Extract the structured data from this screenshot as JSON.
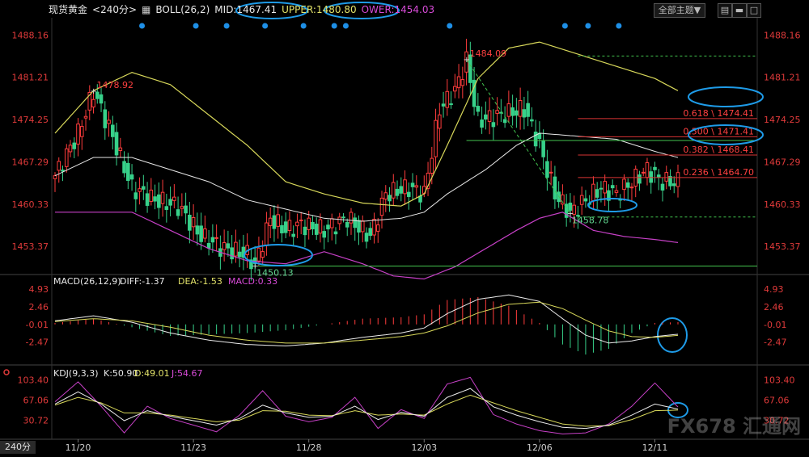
{
  "header": {
    "symbol": "现货黄金",
    "period": "<240分>",
    "indicator": "BOLL(26,2)",
    "mid": "MID:1467.41",
    "upper": "UPPER:1480.80",
    "lower": "OWER:1454.03",
    "theme_button": "全部主题▼"
  },
  "period_tab": "240分",
  "watermark": "FX678 汇通网",
  "chart_data": [
    {
      "type": "candlestick",
      "title": "现货黄金 <240分> BOLL(26,2)",
      "ylim": [
        1449.0,
        1491.0
      ],
      "y_ticks": [
        "1488.16",
        "1481.21",
        "1474.25",
        "1467.29",
        "1460.33",
        "1453.37"
      ],
      "y_tick_values": [
        1488.16,
        1481.21,
        1474.25,
        1467.29,
        1460.33,
        1453.37
      ],
      "x_tick_labels": [
        "11/20",
        "11/23",
        "11/28",
        "12/03",
        "12/06",
        "12/11"
      ],
      "x_tick_index": [
        6,
        36,
        66,
        96,
        126,
        156
      ],
      "annotations": [
        {
          "text": "1478.92",
          "idx": 10,
          "value": 1478.92,
          "color": "#ff4040"
        },
        {
          "text": "1450.13",
          "idx": 52,
          "value": 1450.13,
          "color": "#5fd38d"
        },
        {
          "text": "1484.09",
          "idx": 107,
          "value": 1484.09,
          "color": "#ff4040"
        },
        {
          "text": "1458.78",
          "idx": 134,
          "value": 1458.78,
          "color": "#5fd38d"
        }
      ],
      "fibonacci": [
        {
          "label": "0.618 \\ 1474.41",
          "value": 1474.41
        },
        {
          "label": "0.500 \\ 1471.41",
          "value": 1471.41
        },
        {
          "label": "0.382 \\ 1468.41",
          "value": 1468.41
        },
        {
          "label": "0.236 \\ 1464.70",
          "value": 1464.7
        }
      ],
      "support_levels": [
        1450.13,
        1470.8
      ],
      "ohlc_anchors": [
        [
          0,
          1465
        ],
        [
          6,
          1472
        ],
        [
          10,
          1478.9
        ],
        [
          14,
          1473
        ],
        [
          20,
          1463
        ],
        [
          26,
          1461
        ],
        [
          32,
          1460
        ],
        [
          38,
          1455
        ],
        [
          44,
          1453
        ],
        [
          50,
          1452
        ],
        [
          52,
          1450.2
        ],
        [
          56,
          1458
        ],
        [
          60,
          1456
        ],
        [
          64,
          1457
        ],
        [
          70,
          1456
        ],
        [
          76,
          1458
        ],
        [
          82,
          1455
        ],
        [
          86,
          1462
        ],
        [
          92,
          1463
        ],
        [
          96,
          1462
        ],
        [
          100,
          1476
        ],
        [
          104,
          1479
        ],
        [
          107,
          1484
        ],
        [
          110,
          1474
        ],
        [
          116,
          1475
        ],
        [
          122,
          1476
        ],
        [
          126,
          1470
        ],
        [
          130,
          1462
        ],
        [
          134,
          1458.8
        ],
        [
          138,
          1461
        ],
        [
          142,
          1463
        ],
        [
          146,
          1462
        ],
        [
          150,
          1464
        ],
        [
          154,
          1466
        ],
        [
          158,
          1464
        ],
        [
          162,
          1464
        ]
      ],
      "boll_upper_anchors": [
        [
          0,
          1472
        ],
        [
          10,
          1479
        ],
        [
          20,
          1482
        ],
        [
          30,
          1480
        ],
        [
          40,
          1475
        ],
        [
          50,
          1470
        ],
        [
          60,
          1464
        ],
        [
          70,
          1462
        ],
        [
          80,
          1460.5
        ],
        [
          90,
          1460
        ],
        [
          96,
          1462
        ],
        [
          102,
          1470
        ],
        [
          110,
          1481
        ],
        [
          118,
          1486
        ],
        [
          126,
          1487
        ],
        [
          136,
          1485
        ],
        [
          146,
          1483
        ],
        [
          156,
          1481
        ],
        [
          162,
          1479
        ]
      ],
      "boll_mid_anchors": [
        [
          0,
          1465
        ],
        [
          10,
          1468
        ],
        [
          20,
          1468
        ],
        [
          30,
          1466
        ],
        [
          40,
          1464
        ],
        [
          50,
          1461
        ],
        [
          60,
          1459.5
        ],
        [
          70,
          1458
        ],
        [
          80,
          1457.5
        ],
        [
          90,
          1458
        ],
        [
          96,
          1459
        ],
        [
          102,
          1462
        ],
        [
          112,
          1466
        ],
        [
          120,
          1470
        ],
        [
          126,
          1472
        ],
        [
          136,
          1471.5
        ],
        [
          146,
          1471
        ],
        [
          156,
          1469
        ],
        [
          162,
          1468
        ]
      ],
      "boll_lower_anchors": [
        [
          0,
          1459
        ],
        [
          10,
          1459
        ],
        [
          20,
          1459
        ],
        [
          30,
          1456
        ],
        [
          40,
          1453
        ],
        [
          50,
          1451
        ],
        [
          60,
          1450.5
        ],
        [
          70,
          1452.5
        ],
        [
          80,
          1450.5
        ],
        [
          88,
          1448.5
        ],
        [
          96,
          1448
        ],
        [
          104,
          1450
        ],
        [
          112,
          1453
        ],
        [
          120,
          1456
        ],
        [
          126,
          1458
        ],
        [
          132,
          1459
        ],
        [
          140,
          1456
        ],
        [
          148,
          1455
        ],
        [
          156,
          1454.5
        ],
        [
          162,
          1454
        ]
      ]
    },
    {
      "type": "macd",
      "title": "MACD(26,12,9)",
      "diff_label": "DIFF:-1.37",
      "dea_label": "DEA:-1.53",
      "macd_label": "MACD:0.33",
      "ylim": [
        -5.2,
        5.6
      ],
      "y_ticks": [
        "4.93",
        "2.46",
        "-0.01",
        "-2.47"
      ],
      "y_tick_values": [
        4.93,
        2.46,
        -0.01,
        -2.47
      ],
      "diff_anchors": [
        [
          0,
          0.5
        ],
        [
          10,
          1.2
        ],
        [
          20,
          0.3
        ],
        [
          30,
          -1.2
        ],
        [
          40,
          -2.2
        ],
        [
          50,
          -2.8
        ],
        [
          60,
          -3.0
        ],
        [
          70,
          -2.6
        ],
        [
          80,
          -1.8
        ],
        [
          90,
          -1.2
        ],
        [
          96,
          -0.5
        ],
        [
          102,
          1.5
        ],
        [
          110,
          3.5
        ],
        [
          118,
          4.1
        ],
        [
          126,
          3.2
        ],
        [
          132,
          0.8
        ],
        [
          138,
          -1.5
        ],
        [
          144,
          -2.6
        ],
        [
          150,
          -2.3
        ],
        [
          156,
          -1.7
        ],
        [
          162,
          -1.37
        ]
      ],
      "dea_anchors": [
        [
          0,
          0.4
        ],
        [
          10,
          0.8
        ],
        [
          20,
          0.5
        ],
        [
          30,
          -0.4
        ],
        [
          40,
          -1.5
        ],
        [
          50,
          -2.2
        ],
        [
          60,
          -2.6
        ],
        [
          70,
          -2.6
        ],
        [
          80,
          -2.2
        ],
        [
          90,
          -1.7
        ],
        [
          96,
          -1.2
        ],
        [
          102,
          -0.2
        ],
        [
          110,
          1.6
        ],
        [
          118,
          2.8
        ],
        [
          126,
          3.1
        ],
        [
          132,
          2.2
        ],
        [
          138,
          0.6
        ],
        [
          144,
          -0.9
        ],
        [
          150,
          -1.7
        ],
        [
          156,
          -1.8
        ],
        [
          162,
          -1.53
        ]
      ]
    },
    {
      "type": "kdj",
      "title": "KDJ(9,3,3)",
      "k_label": "K:50.90",
      "d_label": "D:49.01",
      "j_label": "J:54.67",
      "ylim": [
        -2,
        110
      ],
      "y_ticks": [
        "103.40",
        "67.06",
        "30.72"
      ],
      "y_tick_values": [
        103.4,
        67.06,
        30.72
      ],
      "k_anchors": [
        [
          0,
          60
        ],
        [
          6,
          82
        ],
        [
          12,
          60
        ],
        [
          18,
          30
        ],
        [
          24,
          48
        ],
        [
          30,
          38
        ],
        [
          36,
          30
        ],
        [
          42,
          22
        ],
        [
          48,
          34
        ],
        [
          54,
          58
        ],
        [
          60,
          44
        ],
        [
          66,
          36
        ],
        [
          72,
          38
        ],
        [
          78,
          56
        ],
        [
          84,
          32
        ],
        [
          90,
          45
        ],
        [
          96,
          38
        ],
        [
          102,
          72
        ],
        [
          108,
          88
        ],
        [
          114,
          55
        ],
        [
          120,
          40
        ],
        [
          126,
          28
        ],
        [
          132,
          18
        ],
        [
          138,
          16
        ],
        [
          144,
          22
        ],
        [
          150,
          40
        ],
        [
          156,
          60
        ],
        [
          162,
          50.9
        ]
      ],
      "d_anchors": [
        [
          0,
          58
        ],
        [
          6,
          72
        ],
        [
          12,
          62
        ],
        [
          18,
          44
        ],
        [
          24,
          44
        ],
        [
          30,
          40
        ],
        [
          36,
          34
        ],
        [
          42,
          28
        ],
        [
          48,
          31
        ],
        [
          54,
          48
        ],
        [
          60,
          47
        ],
        [
          66,
          40
        ],
        [
          72,
          39
        ],
        [
          78,
          48
        ],
        [
          84,
          40
        ],
        [
          90,
          42
        ],
        [
          96,
          40
        ],
        [
          102,
          60
        ],
        [
          108,
          76
        ],
        [
          114,
          62
        ],
        [
          120,
          48
        ],
        [
          126,
          36
        ],
        [
          132,
          24
        ],
        [
          138,
          20
        ],
        [
          144,
          21
        ],
        [
          150,
          32
        ],
        [
          156,
          48
        ],
        [
          162,
          49.01
        ]
      ],
      "j_anchors": [
        [
          0,
          64
        ],
        [
          6,
          100
        ],
        [
          12,
          56
        ],
        [
          18,
          8
        ],
        [
          24,
          56
        ],
        [
          30,
          34
        ],
        [
          36,
          22
        ],
        [
          42,
          10
        ],
        [
          48,
          40
        ],
        [
          54,
          84
        ],
        [
          60,
          38
        ],
        [
          66,
          28
        ],
        [
          72,
          36
        ],
        [
          78,
          72
        ],
        [
          84,
          16
        ],
        [
          90,
          50
        ],
        [
          96,
          34
        ],
        [
          102,
          96
        ],
        [
          108,
          108
        ],
        [
          114,
          41
        ],
        [
          120,
          24
        ],
        [
          126,
          12
        ],
        [
          132,
          6
        ],
        [
          138,
          8
        ],
        [
          144,
          24
        ],
        [
          150,
          56
        ],
        [
          156,
          98
        ],
        [
          162,
          54.67
        ]
      ]
    }
  ]
}
